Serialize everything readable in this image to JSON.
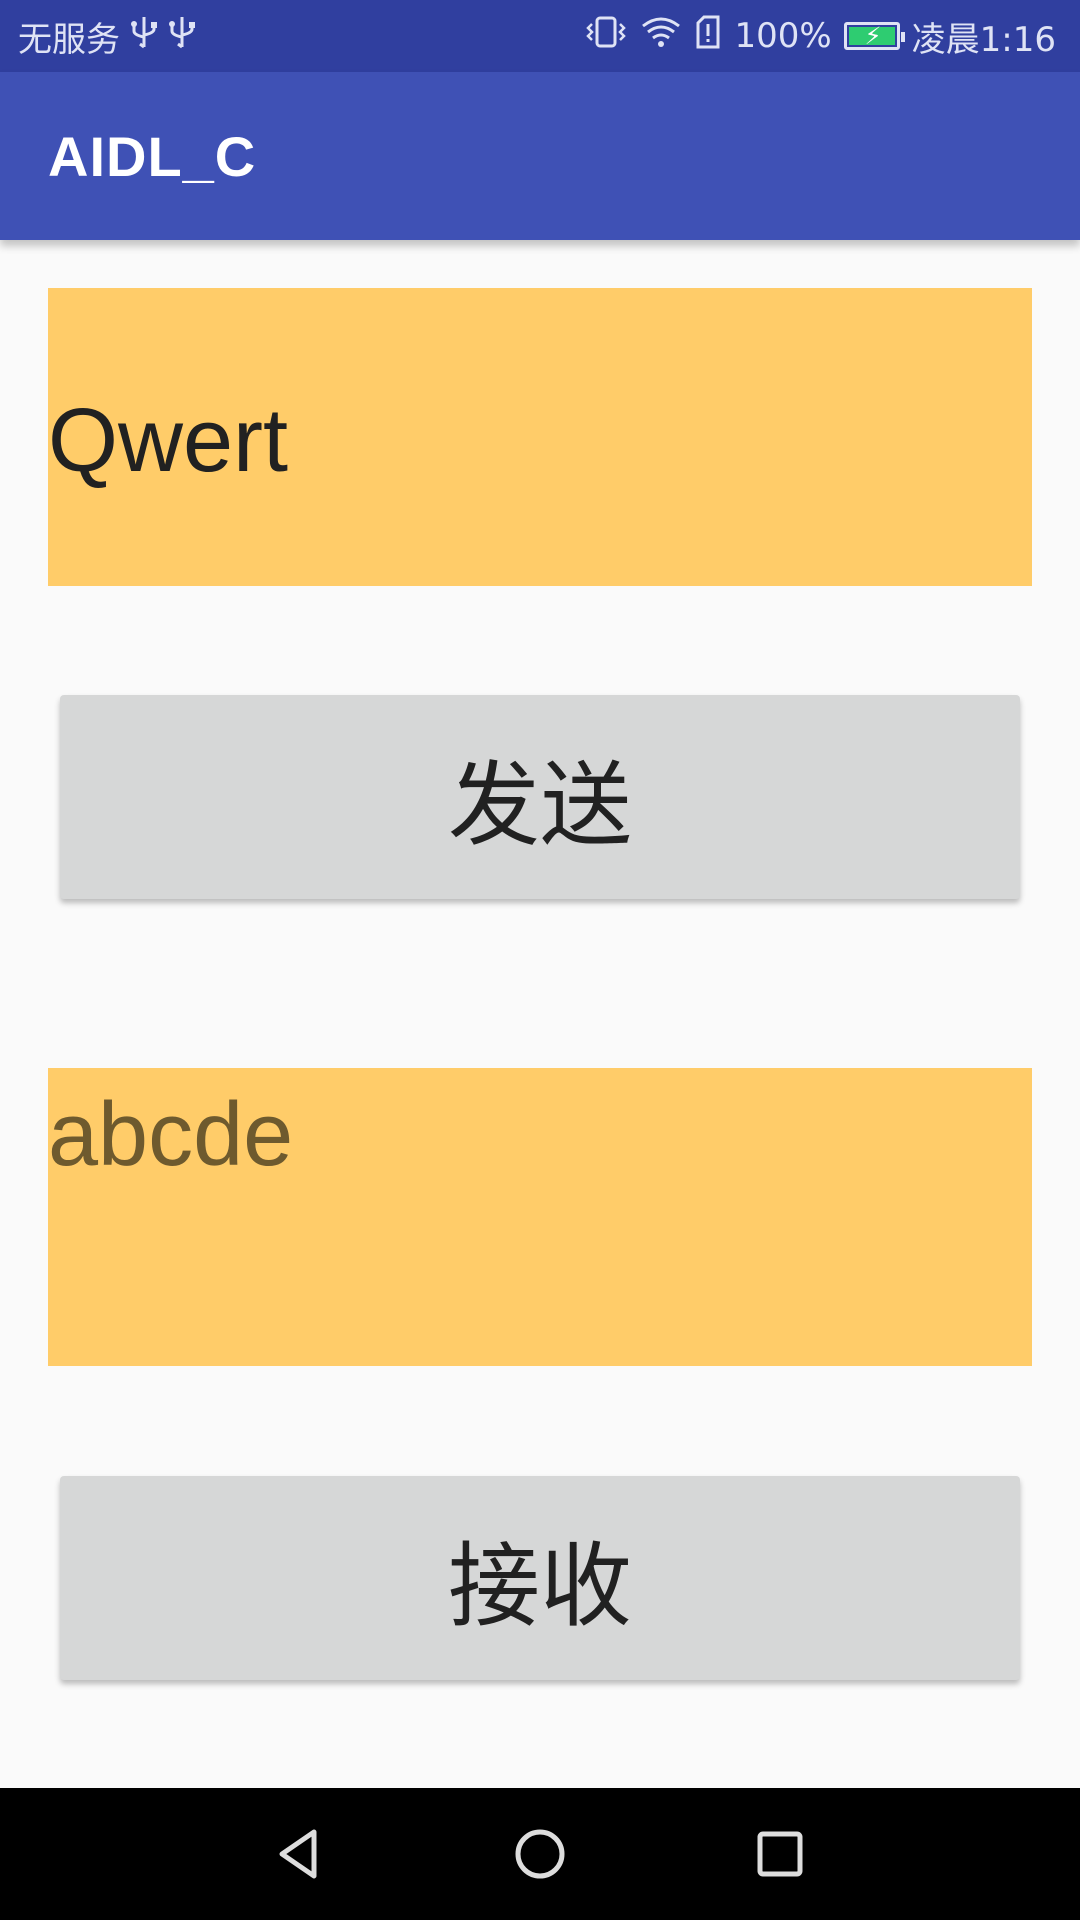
{
  "status_bar": {
    "carrier": "无服务",
    "usb_icons": [
      "usb-icon",
      "usb-icon"
    ],
    "battery_percent": "100%",
    "battery_level": 1.0,
    "time": "凌晨1:16",
    "icons": [
      "vibrate-icon",
      "wifi-icon",
      "sim-alert-icon",
      "battery-charging-icon"
    ]
  },
  "app_bar": {
    "title": "AIDL_C"
  },
  "input_panel": {
    "text": "Qwert"
  },
  "send_button": {
    "label": "发送"
  },
  "output_panel": {
    "text": "abcde"
  },
  "receive_button": {
    "label": "接收"
  },
  "nav_bar": {
    "buttons": [
      "back-icon",
      "home-icon",
      "recents-icon"
    ]
  },
  "colors": {
    "status_bar": "#303f9f",
    "app_bar": "#3f51b5",
    "panel": "#ffcc69",
    "button": "#d6d7d7",
    "battery_fill": "#2ecc71"
  }
}
